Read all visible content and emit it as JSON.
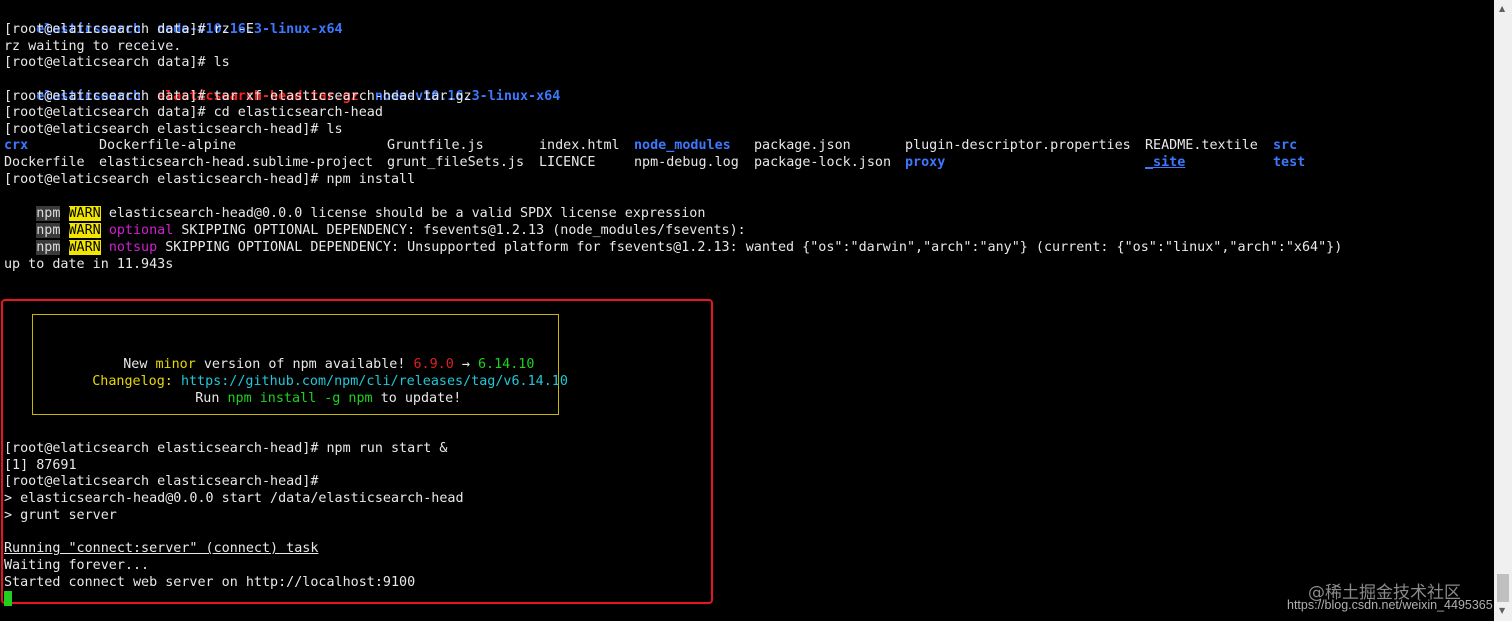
{
  "terminal": {
    "l1": {
      "a": "elasticsearch",
      "b": "node-v10.16.3-linux-x64"
    },
    "l2": "[root@elaticsearch data]# rz -E",
    "l3": "rz waiting to receive.",
    "l4": "[root@elaticsearch data]# ls",
    "l5": {
      "a": "elasticsearch",
      "b": "elasticsearch-head.tar.gz",
      "c": "node-v10.16.3-linux-x64"
    },
    "l6": "[root@elaticsearch data]# tar xf elasticsearch-head.tar.gz",
    "l7": "[root@elaticsearch data]# cd elasticsearch-head",
    "l8": "[root@elaticsearch elasticsearch-head]# ls",
    "ls_row1": [
      "crx",
      "Dockerfile-alpine",
      "Gruntfile.js",
      "index.html",
      "node_modules",
      "package.json",
      "plugin-descriptor.properties",
      "README.textile",
      "src"
    ],
    "ls_row2": [
      "Dockerfile",
      "elasticsearch-head.sublime-project",
      "grunt_fileSets.js",
      "LICENCE",
      "npm-debug.log",
      "package-lock.json",
      "proxy",
      "_site",
      "test"
    ],
    "l11": "[root@elaticsearch elasticsearch-head]# npm install",
    "npm_tag": "npm",
    "warn_tag": "WARN",
    "w1": "elasticsearch-head@0.0.0 license should be a valid SPDX license expression",
    "w2": {
      "kw": "optional",
      "msg": "SKIPPING OPTIONAL DEPENDENCY: fsevents@1.2.13 (node_modules/fsevents):"
    },
    "w3": {
      "kw": "notsup",
      "msg": "SKIPPING OPTIONAL DEPENDENCY: Unsupported platform for fsevents@1.2.13: wanted {\"os\":\"darwin\",\"arch\":\"any\"} (current: {\"os\":\"linux\",\"arch\":\"x64\"})"
    },
    "up_to_date": "up to date in 11.943s",
    "box": {
      "l1": {
        "a": "New",
        "b": "minor",
        "c": "version of npm available!",
        "d": "6.9.0",
        "e": "→",
        "f": "6.14.10"
      },
      "l2": {
        "a": "Changelog:",
        "b": "https://github.com/npm/cli/releases/tag/v6.14.10"
      },
      "l3": {
        "a": "Run",
        "b": "npm install -g npm",
        "c": "to update!"
      }
    },
    "r1": "[root@elaticsearch elasticsearch-head]# npm run start &",
    "r2": "[1] 87691",
    "r3": "[root@elaticsearch elasticsearch-head]#",
    "r4": "> elasticsearch-head@0.0.0 start /data/elasticsearch-head",
    "r5": "> grunt server",
    "r6": "Running \"connect:server\" (connect) task",
    "r7": "Waiting forever...",
    "r8": "Started connect web server on http://localhost:9100"
  },
  "watermark": {
    "line1": "@稀土掘金技术社区",
    "line2": "https://blog.csdn.net/weixin_4495365"
  },
  "scrollbar": {
    "up": "▲",
    "down": "▼"
  },
  "colors": {
    "directory": "#3c78ff",
    "archive": "#ff2020",
    "warn_bg": "#f2e600",
    "highlight_border": "#e8151f",
    "cursor": "#1fd01f"
  }
}
